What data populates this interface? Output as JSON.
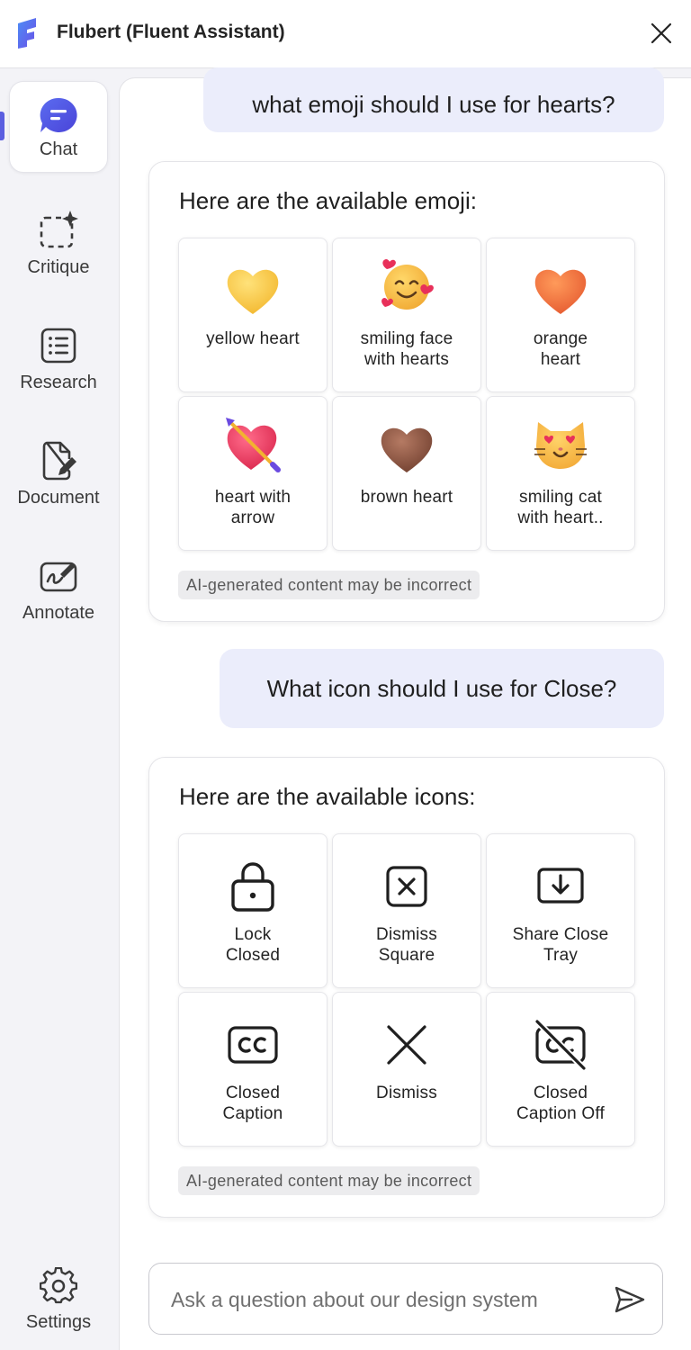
{
  "app": {
    "title": "Flubert (Fluent Assistant)"
  },
  "sidebar": {
    "items": [
      {
        "label": "Chat",
        "icon": "chat-icon"
      },
      {
        "label": "Critique",
        "icon": "critique-icon"
      },
      {
        "label": "Research",
        "icon": "research-icon"
      },
      {
        "label": "Document",
        "icon": "document-icon"
      },
      {
        "label": "Annotate",
        "icon": "annotate-icon"
      }
    ],
    "settings_label": "Settings"
  },
  "conversation": {
    "user_message_1": "what emoji should I use for hearts?",
    "reply_1": {
      "title": "Here are the available emoji:",
      "tiles": [
        {
          "label": "yellow heart",
          "icon": "yellow-heart-emoji"
        },
        {
          "label": "smiling face\nwith hearts",
          "icon": "smiling-face-with-hearts-emoji"
        },
        {
          "label": "orange\nheart",
          "icon": "orange-heart-emoji"
        },
        {
          "label": "heart with\narrow",
          "icon": "heart-with-arrow-emoji"
        },
        {
          "label": "brown heart",
          "icon": "brown-heart-emoji"
        },
        {
          "label": "smiling cat\nwith heart..",
          "icon": "smiling-cat-with-heart-eyes-emoji"
        }
      ],
      "disclaimer": "AI-generated content may be incorrect"
    },
    "user_message_2": "What icon should I use for Close?",
    "reply_2": {
      "title": "Here are the available icons:",
      "tiles": [
        {
          "label": "Lock\nClosed",
          "icon": "lock-closed-icon"
        },
        {
          "label": "Dismiss\nSquare",
          "icon": "dismiss-square-icon"
        },
        {
          "label": "Share Close\nTray",
          "icon": "share-close-tray-icon"
        },
        {
          "label": "Closed\nCaption",
          "icon": "closed-caption-icon"
        },
        {
          "label": "Dismiss",
          "icon": "dismiss-icon"
        },
        {
          "label": "Closed\nCaption Off",
          "icon": "closed-caption-off-icon"
        }
      ],
      "disclaimer": "AI-generated content may be incorrect"
    }
  },
  "composer": {
    "placeholder": "Ask a question about our design system"
  },
  "colors": {
    "accent": "#5b5fe0",
    "user_bubble": "#ebedfb"
  }
}
